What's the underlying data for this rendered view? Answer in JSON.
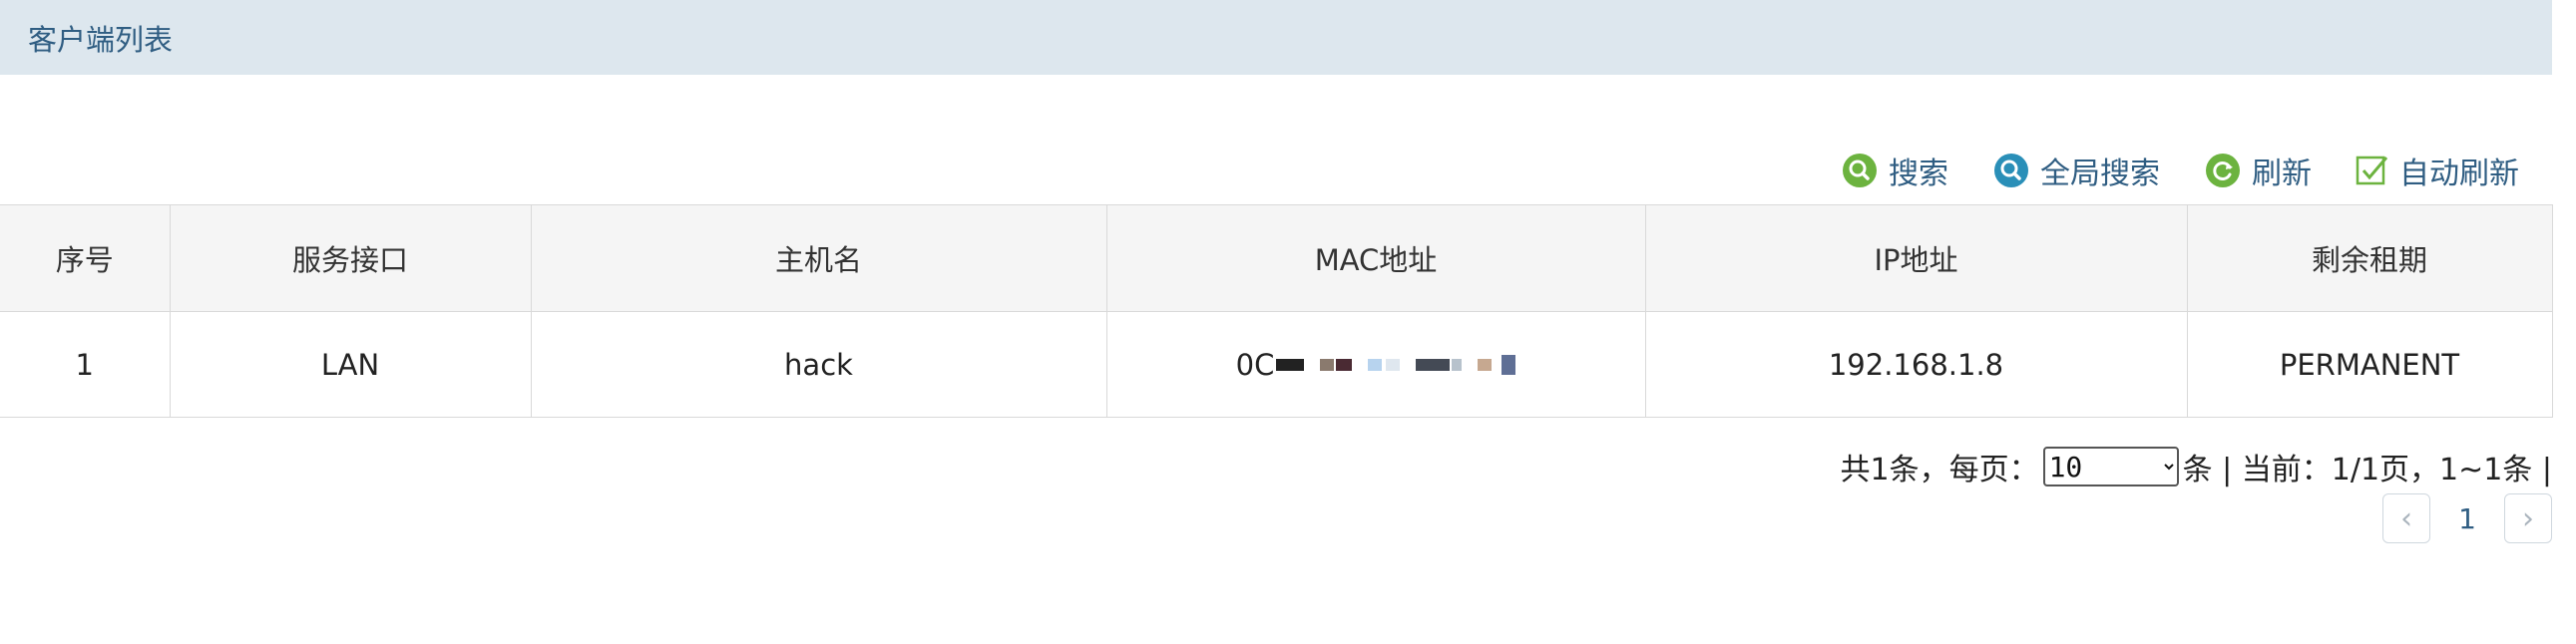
{
  "header": {
    "title": "客户端列表"
  },
  "toolbar": {
    "search_label": "搜索",
    "global_search_label": "全局搜索",
    "refresh_label": "刷新",
    "auto_refresh_label": "自动刷新",
    "auto_refresh_checked": true
  },
  "table": {
    "columns": [
      "序号",
      "服务接口",
      "主机名",
      "MAC地址",
      "IP地址",
      "剩余租期"
    ],
    "rows": [
      {
        "index": "1",
        "interface": "LAN",
        "hostname": "hack",
        "mac_prefix": "0C",
        "ip": "192.168.1.8",
        "lease": "PERMANENT"
      }
    ]
  },
  "pagination": {
    "total_prefix": "共1条，每页：",
    "page_size": "10",
    "page_size_options": [
      "10"
    ],
    "summary": "条 | 当前：1/1页，1~1条 |",
    "current_page": "1",
    "prev_icon": "‹",
    "next_icon": "›"
  },
  "colors": {
    "titlebar_bg": "#dde7ee",
    "accent_text": "#2f5d82",
    "icon_green": "#6cb33f",
    "icon_blue": "#2a8fb8"
  }
}
